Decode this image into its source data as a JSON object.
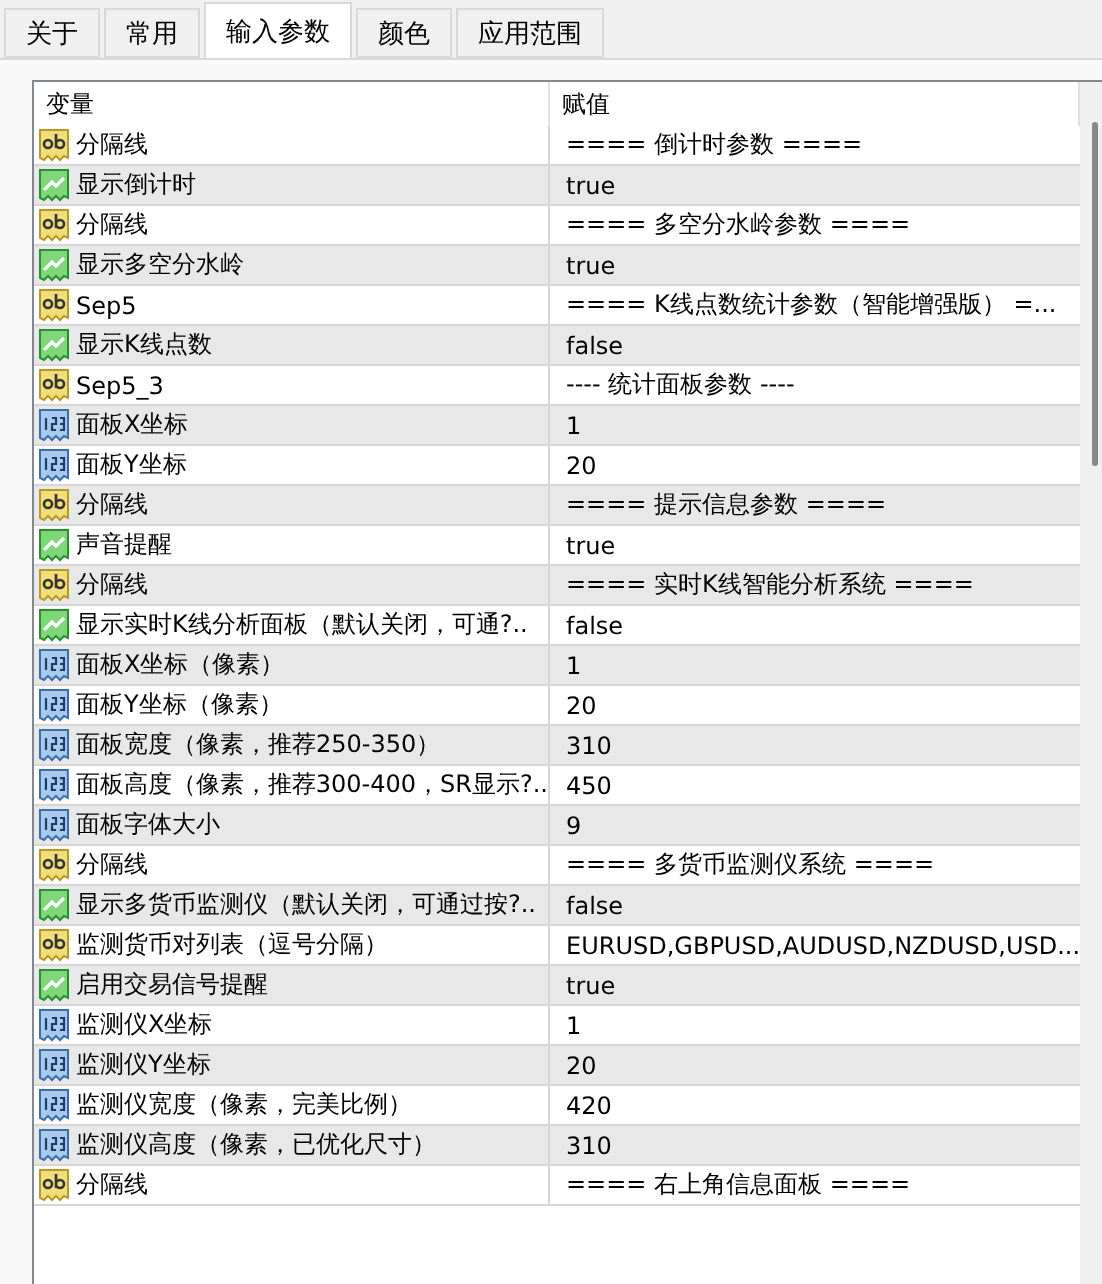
{
  "tabs": [
    {
      "label": "关于",
      "selected": false
    },
    {
      "label": "常用",
      "selected": false
    },
    {
      "label": "输入参数",
      "selected": true
    },
    {
      "label": "颜色",
      "selected": false
    },
    {
      "label": "应用范围",
      "selected": false
    }
  ],
  "table": {
    "columns": [
      "变量",
      "赋值"
    ],
    "rows": [
      {
        "kind": "string",
        "name": "分隔线",
        "value": "==== 倒计时参数 ===="
      },
      {
        "kind": "bool",
        "name": "显示倒计时",
        "value": "true"
      },
      {
        "kind": "string",
        "name": "分隔线",
        "value": "==== 多空分水岭参数 ===="
      },
      {
        "kind": "bool",
        "name": "显示多空分水岭",
        "value": "true"
      },
      {
        "kind": "string",
        "name": "Sep5",
        "value": "==== K线点数统计参数（智能增强版） =..."
      },
      {
        "kind": "bool",
        "name": "显示K线点数",
        "value": "false"
      },
      {
        "kind": "string",
        "name": "Sep5_3",
        "value": "---- 统计面板参数 ----"
      },
      {
        "kind": "int",
        "name": "面板X坐标",
        "value": "1"
      },
      {
        "kind": "int",
        "name": "面板Y坐标",
        "value": "20"
      },
      {
        "kind": "string",
        "name": "分隔线",
        "value": "==== 提示信息参数 ===="
      },
      {
        "kind": "bool",
        "name": "声音提醒",
        "value": "true"
      },
      {
        "kind": "string",
        "name": "分隔线",
        "value": "==== 实时K线智能分析系统 ===="
      },
      {
        "kind": "bool",
        "name": "显示实时K线分析面板（默认关闭，可通?..",
        "value": "false"
      },
      {
        "kind": "int",
        "name": "面板X坐标（像素）",
        "value": "1"
      },
      {
        "kind": "int",
        "name": "面板Y坐标（像素）",
        "value": "20"
      },
      {
        "kind": "int",
        "name": "面板宽度（像素，推荐250-350）",
        "value": "310"
      },
      {
        "kind": "int",
        "name": "面板高度（像素，推荐300-400，SR显示?..",
        "value": "450"
      },
      {
        "kind": "int",
        "name": "面板字体大小",
        "value": "9"
      },
      {
        "kind": "string",
        "name": "分隔线",
        "value": "==== 多货币监测仪系统 ===="
      },
      {
        "kind": "bool",
        "name": "显示多货币监测仪（默认关闭，可通过按?..",
        "value": "false"
      },
      {
        "kind": "string",
        "name": "监测货币对列表（逗号分隔）",
        "value": "EURUSD,GBPUSD,AUDUSD,NZDUSD,USD..."
      },
      {
        "kind": "bool",
        "name": "启用交易信号提醒",
        "value": "true"
      },
      {
        "kind": "int",
        "name": "监测仪X坐标",
        "value": "1"
      },
      {
        "kind": "int",
        "name": "监测仪Y坐标",
        "value": "20"
      },
      {
        "kind": "int",
        "name": "监测仪宽度（像素，完美比例）",
        "value": "420"
      },
      {
        "kind": "int",
        "name": "监测仪高度（像素，已优化尺寸）",
        "value": "310"
      },
      {
        "kind": "string",
        "name": "分隔线",
        "value": "==== 右上角信息面板 ===="
      }
    ]
  }
}
